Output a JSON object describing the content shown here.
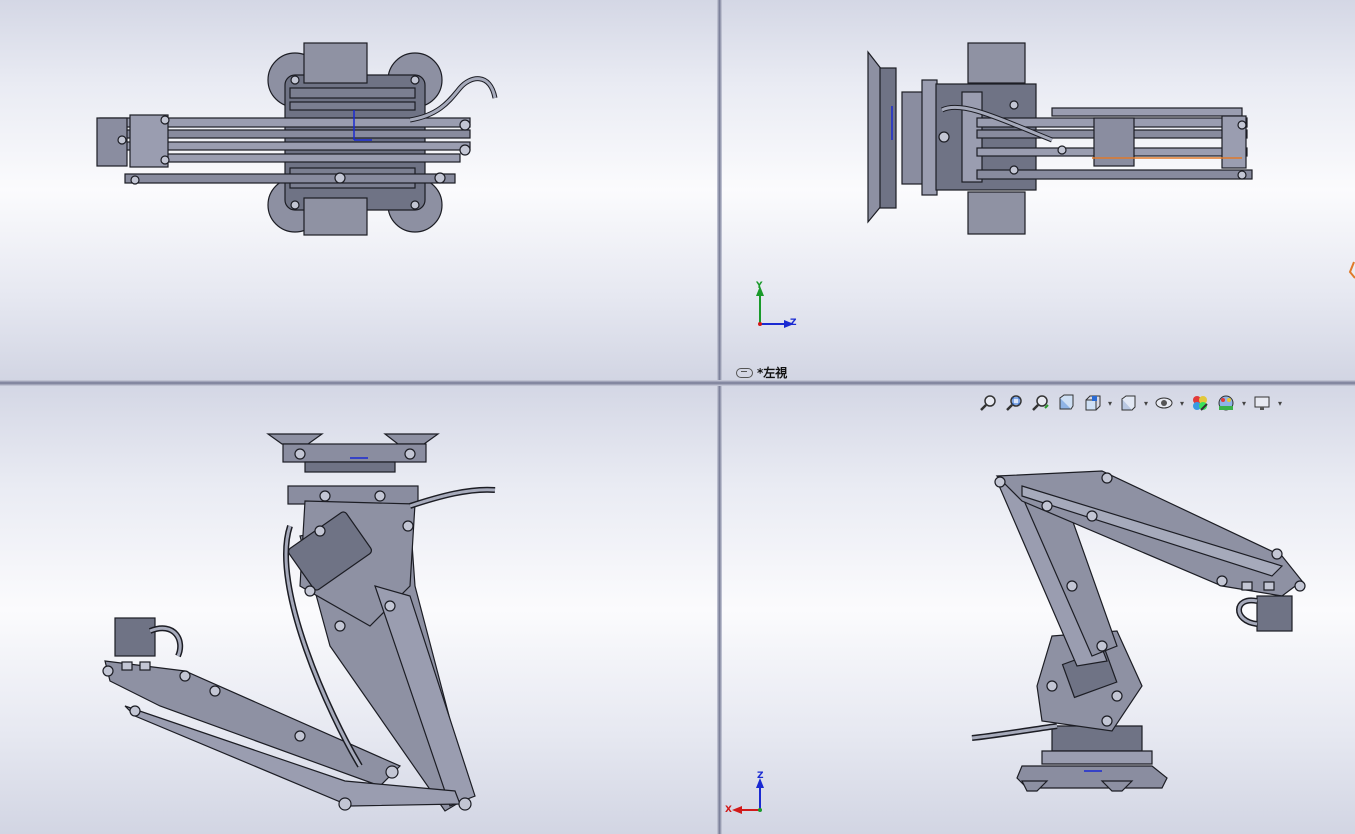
{
  "viewports": {
    "top_left": {
      "name": "top-view"
    },
    "top_right": {
      "name": "left-view",
      "label": "*左視",
      "triad": {
        "y": "Y",
        "z": "Z"
      }
    },
    "bottom_left": {
      "name": "front-view"
    },
    "bottom_right": {
      "name": "isometric-view",
      "triad": {
        "z": "Z",
        "x": "X"
      }
    }
  },
  "heads_up_toolbar": {
    "items": [
      "zoom-to-fit-icon",
      "zoom-to-area-icon",
      "previous-view-icon",
      "section-view-icon",
      "view-orientation-icon",
      "display-style-icon",
      "hide-show-items-icon",
      "edit-appearance-icon",
      "apply-scene-icon",
      "view-settings-icon"
    ]
  },
  "colors": {
    "part_fill": "#7b7f91",
    "part_light": "#a6aabb",
    "edge": "#1c1d24",
    "triad_x": "#d21a1a",
    "triad_y": "#1a9a2a",
    "triad_z": "#1a2ad2"
  }
}
